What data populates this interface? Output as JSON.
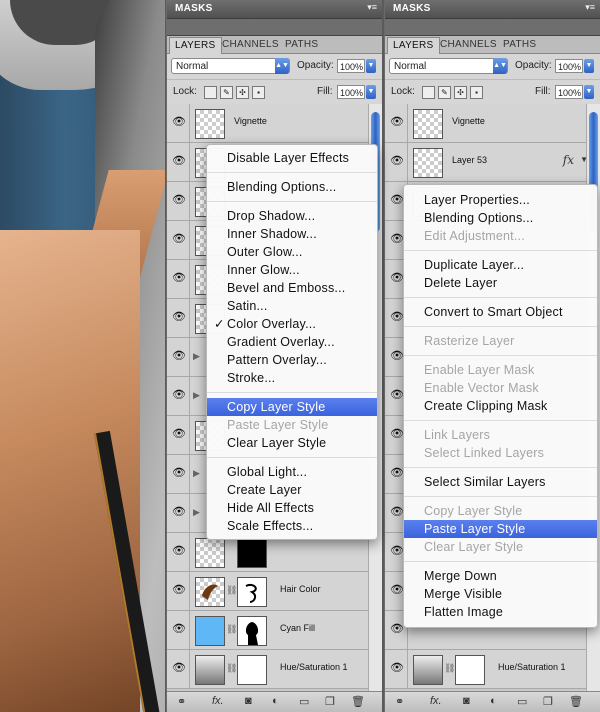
{
  "panel_header": {
    "tab": "MASKS",
    "menu_icon": "panel-menu-icon"
  },
  "tabs": [
    "LAYERS",
    "CHANNELS",
    "PATHS"
  ],
  "blend_mode": "Normal",
  "opacity_label": "Opacity:",
  "opacity_value": "100%",
  "lock_label": "Lock:",
  "fill_label": "Fill:",
  "fill_value": "100%",
  "left_panel": {
    "layers": [
      "Vignette",
      "",
      "",
      "",
      "",
      "",
      "",
      "",
      "",
      "",
      "",
      "",
      "Hair Color",
      "Cyan Fill",
      "Hue/Saturation 1"
    ],
    "menu": {
      "disable_effects": "Disable Layer Effects",
      "blending_options": "Blending Options...",
      "drop_shadow": "Drop Shadow...",
      "inner_shadow": "Inner Shadow...",
      "outer_glow": "Outer Glow...",
      "inner_glow": "Inner Glow...",
      "bevel": "Bevel and Emboss...",
      "satin": "Satin...",
      "color_overlay": "Color Overlay...",
      "gradient_overlay": "Gradient Overlay...",
      "pattern_overlay": "Pattern Overlay...",
      "stroke": "Stroke...",
      "copy_style": "Copy Layer Style",
      "paste_style": "Paste Layer Style",
      "clear_style": "Clear Layer Style",
      "global_light": "Global Light...",
      "create_layer": "Create Layer",
      "hide_effects": "Hide All Effects",
      "scale_effects": "Scale Effects...",
      "check": "✓"
    }
  },
  "right_panel": {
    "layers": [
      "Vignette",
      "Layer 53",
      "",
      "",
      "",
      "",
      "",
      "",
      "",
      "",
      "",
      "",
      "",
      "",
      "Hue/Saturation 1"
    ],
    "fx": "fx",
    "menu": {
      "layer_properties": "Layer Properties...",
      "blending_options": "Blending Options...",
      "edit_adjustment": "Edit Adjustment...",
      "duplicate_layer": "Duplicate Layer...",
      "delete_layer": "Delete Layer",
      "convert_smart": "Convert to Smart Object",
      "rasterize": "Rasterize Layer",
      "enable_layer_mask": "Enable Layer Mask",
      "enable_vector_mask": "Enable Vector Mask",
      "create_clipping_mask": "Create Clipping Mask",
      "link_layers": "Link Layers",
      "select_linked": "Select Linked Layers",
      "select_similar": "Select Similar Layers",
      "copy_style": "Copy Layer Style",
      "paste_style": "Paste Layer Style",
      "clear_style": "Clear Layer Style",
      "merge_down": "Merge Down",
      "merge_visible": "Merge Visible",
      "flatten": "Flatten Image"
    }
  },
  "colors": {
    "highlight": "#3a63dd",
    "cyan_fill": "#5fb7f5"
  }
}
